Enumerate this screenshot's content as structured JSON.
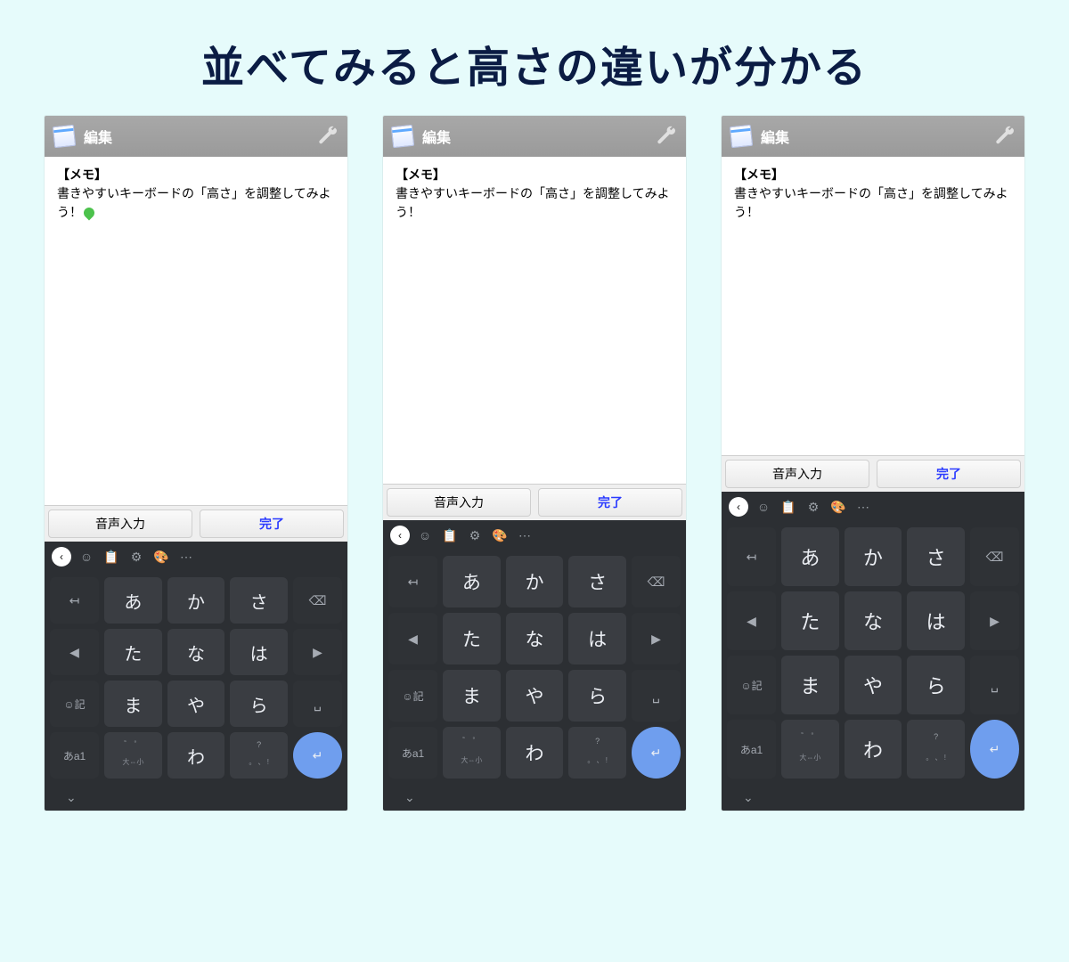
{
  "heading": "並べてみると高さの違いが分かる",
  "titlebar": {
    "title": "編集"
  },
  "note": {
    "label": "【メモ】",
    "body": "書きやすいキーボードの「高さ」を調整してみよう！"
  },
  "pills": {
    "voice": "音声入力",
    "done": "完了"
  },
  "toolbar": {
    "back": "‹",
    "icons": [
      "sticker-icon",
      "clipboard-icon",
      "gear-icon",
      "palette-icon",
      "more-icon"
    ]
  },
  "keys": {
    "row1": {
      "left": "↤",
      "a": "あ",
      "ka": "か",
      "sa": "さ",
      "del": "⌫"
    },
    "row2": {
      "cl": "◀",
      "ta": "た",
      "na": "な",
      "ha": "は",
      "cr": "▶"
    },
    "row3": {
      "emo": "☺記",
      "ma": "ま",
      "ya": "や",
      "ra": "ら",
      "space": "␣"
    },
    "row4": {
      "mode": "あa1",
      "punct_top": "゛ ゜",
      "punct_bot": "大⇔小",
      "wa": "わ",
      "sym_top": "?",
      "sym_bot": "。 、 !",
      "enter": "↵"
    }
  },
  "bottombar": {
    "collapse": "⌄"
  }
}
